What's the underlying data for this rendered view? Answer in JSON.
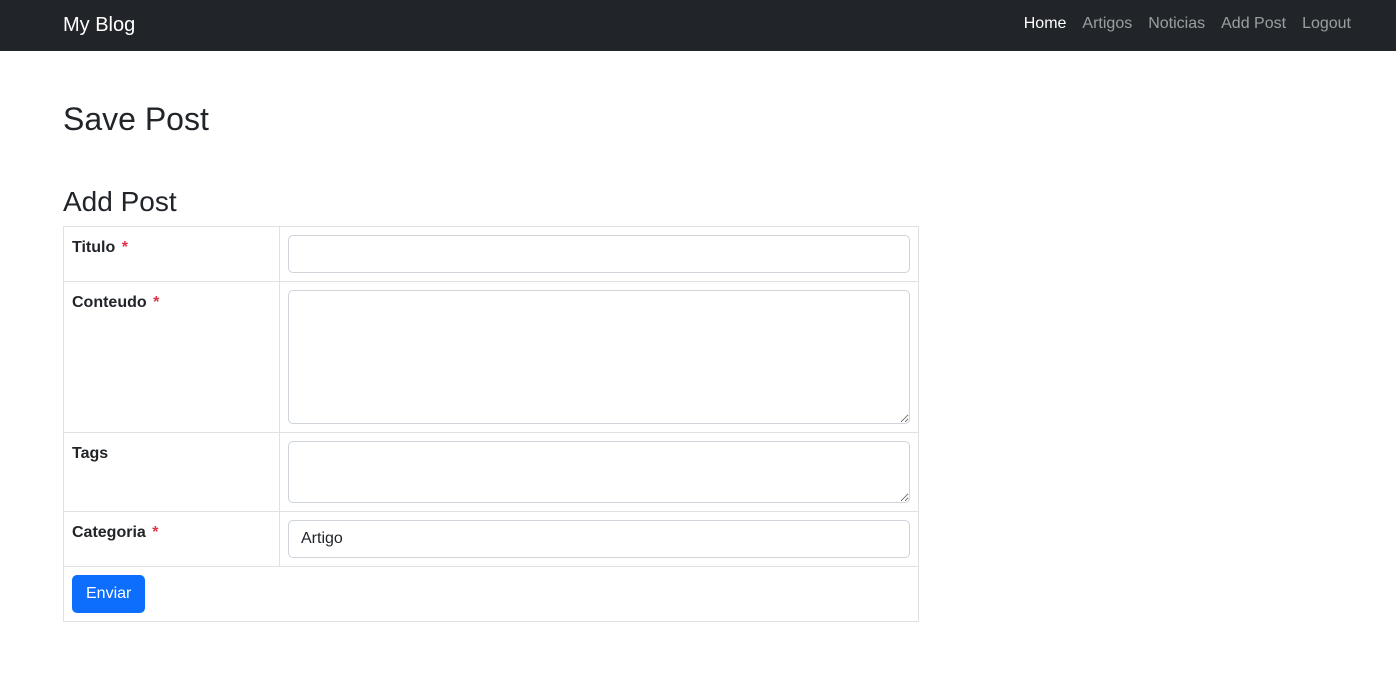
{
  "navbar": {
    "brand": "My Blog",
    "links": [
      {
        "label": "Home",
        "active": true
      },
      {
        "label": "Artigos",
        "active": false
      },
      {
        "label": "Noticias",
        "active": false
      },
      {
        "label": "Add Post",
        "active": false
      },
      {
        "label": "Logout",
        "active": false
      }
    ]
  },
  "page": {
    "title": "Save Post",
    "section_title": "Add Post"
  },
  "form": {
    "required_marker": "*",
    "fields": {
      "titulo": {
        "label": "Titulo",
        "value": "",
        "required": true
      },
      "conteudo": {
        "label": "Conteudo",
        "value": "",
        "required": true
      },
      "tags": {
        "label": "Tags",
        "value": "",
        "required": false
      },
      "categoria": {
        "label": "Categoria",
        "value": "Artigo",
        "required": true
      }
    },
    "submit_label": "Enviar"
  },
  "colors": {
    "navbar_bg": "#212529",
    "primary": "#0d6efd",
    "required": "#dc3545"
  }
}
